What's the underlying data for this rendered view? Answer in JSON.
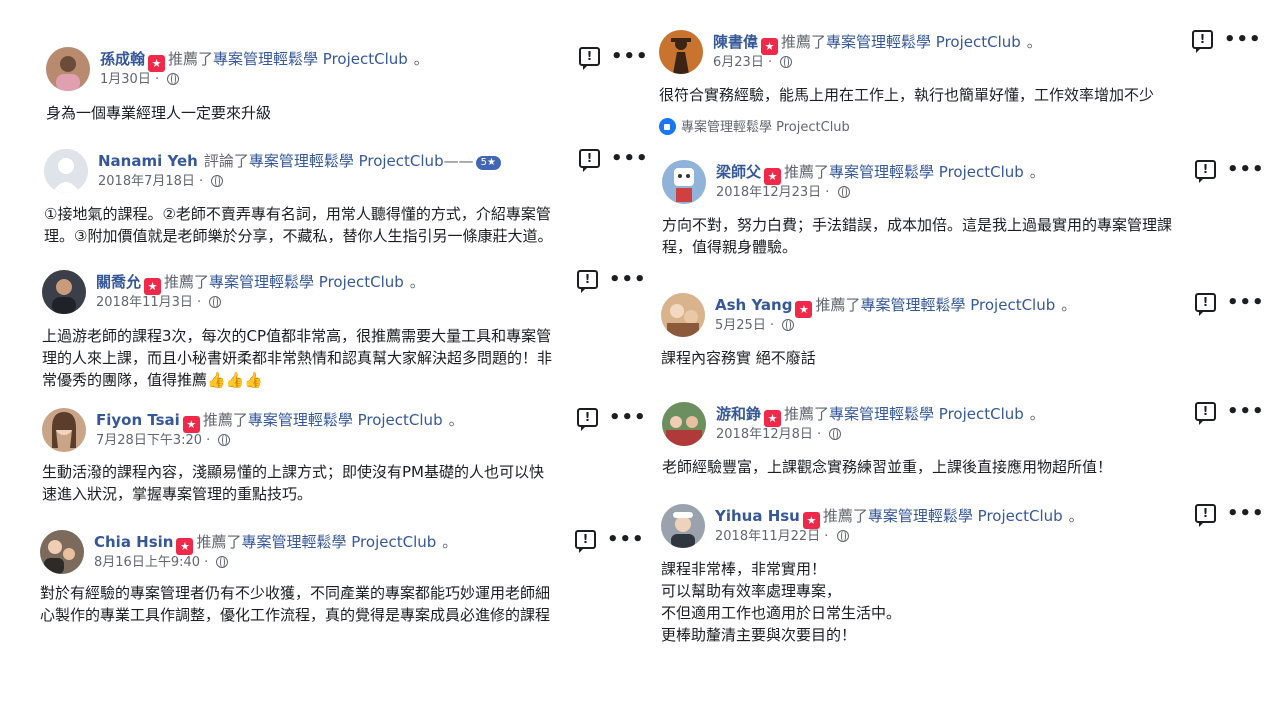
{
  "recommend_badge": "★",
  "globe_icon": "globe-icon",
  "reviews": [
    {
      "name": "孫成翰",
      "action": "推薦了",
      "page": "專案管理輕鬆學 ProjectClub",
      "date": "1月30日",
      "text": "身為一個專業經理人一定要來升級",
      "avatar_color": "#b98b6e"
    },
    {
      "name": "Nanami Yeh",
      "action": "評論了",
      "page": "專案管理輕鬆學 ProjectClub",
      "rating_text": "5★",
      "date": "2018年7月18日",
      "text": "①接地氣的課程。②老師不賣弄專有名詞，用常人聽得懂的方式，介紹專案管\n理。③附加價值就是老師樂於分享，不藏私，替你人生指引另一條康莊大道。",
      "avatar_color": "#dfe3ea"
    },
    {
      "name": "關喬允",
      "action": "推薦了",
      "page": "專案管理輕鬆學 ProjectClub",
      "date": "2018年11月3日",
      "text": "上過游老師的課程3次，每次的CP值都非常高，很推薦需要大量工具和專案管\n理的人來上課，而且小秘書妍柔都非常熱情和認真幫大家解決超多問題的！非\n常優秀的團隊，值得推薦👍👍👍",
      "avatar_color": "#3a3f4a"
    },
    {
      "name": "Fiyon Tsai",
      "action": "推薦了",
      "page": "專案管理輕鬆學 ProjectClub",
      "date": "7月28日下午3:20",
      "text": "生動活潑的課程內容，淺顯易懂的上課方式；即使沒有PM基礎的人也可以快\n速進入狀況，掌握專案管理的重點技巧。",
      "avatar_color": "#c9a487"
    },
    {
      "name": "Chia Hsin",
      "action": "推薦了",
      "page": "專案管理輕鬆學 ProjectClub",
      "date": "8月16日上午9:40",
      "text": "對於有經驗的專案管理者仍有不少收獲，不同產業的專案都能巧妙運用老師細\n心製作的專業工具作調整，優化工作流程，真的覺得是專案成員必進修的課程",
      "avatar_color": "#7c6a5c"
    },
    {
      "name": "陳書偉",
      "action": "推薦了",
      "page": "專案管理輕鬆學 ProjectClub",
      "date": "6月23日",
      "text": "很符合實務經驗，能馬上用在工作上，執行也簡單好懂，工作效率增加不少",
      "liked_by": "專案管理輕鬆學 ProjectClub",
      "avatar_color": "#c8732e"
    },
    {
      "name": "梁師父",
      "action": "推薦了",
      "page": "專案管理輕鬆學 ProjectClub",
      "date": "2018年12月23日",
      "text": "方向不對，努力白費；手法錯誤，成本加倍。這是我上過最實用的專案管理課\n程，值得親身體驗。",
      "avatar_color": "#8fb3d9"
    },
    {
      "name": "Ash Yang",
      "action": "推薦了",
      "page": "專案管理輕鬆學 ProjectClub",
      "date": "5月25日",
      "text": "課程內容務實 絕不廢話",
      "avatar_color": "#d9b38c"
    },
    {
      "name": "游和錚",
      "action": "推薦了",
      "page": "專案管理輕鬆學 ProjectClub",
      "date": "2018年12月8日",
      "text": "老師經驗豐富，上課觀念實務練習並重，上課後直接應用物超所值！",
      "avatar_color": "#6b8f5e"
    },
    {
      "name": "Yihua Hsu",
      "action": "推薦了",
      "page": "專案管理輕鬆學 ProjectClub",
      "date": "2018年11月22日",
      "text": "課程非常棒，非常實用！\n可以幫助有效率處理專案，\n不但適用工作也適用於日常生活中。\n更棒助釐清主要與次要目的！",
      "avatar_color": "#9aa3ad"
    }
  ]
}
